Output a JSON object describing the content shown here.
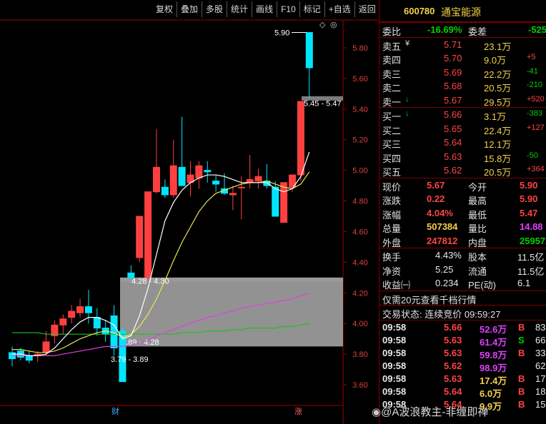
{
  "toolbar": [
    "复权",
    "叠加",
    "多股",
    "统计",
    "画线",
    "F10",
    "标记",
    "+自选",
    "返回"
  ],
  "stock": {
    "code": "600780",
    "name": "通宝能源"
  },
  "quote": {
    "weibi_label": "委比",
    "weibi": "-16.69%",
    "weicha_label": "委差",
    "weicha": "-525",
    "sells": [
      {
        "label": "卖五",
        "price": "5.71",
        "vol": "23.1万",
        "chg": "",
        "mark": "¥"
      },
      {
        "label": "卖四",
        "price": "5.70",
        "vol": "9.0万",
        "chg": "+5",
        "mark": ""
      },
      {
        "label": "卖三",
        "price": "5.69",
        "vol": "22.2万",
        "chg": "-41",
        "mark": ""
      },
      {
        "label": "卖二",
        "price": "5.68",
        "vol": "20.5万",
        "chg": "-210",
        "mark": ""
      },
      {
        "label": "卖一",
        "price": "5.67",
        "vol": "29.5万",
        "chg": "+520",
        "mark": "↓"
      }
    ],
    "buys": [
      {
        "label": "买一",
        "price": "5.66",
        "vol": "3.1万",
        "chg": "-383",
        "mark": "↓"
      },
      {
        "label": "买二",
        "price": "5.65",
        "vol": "22.4万",
        "chg": "+127",
        "mark": ""
      },
      {
        "label": "买三",
        "price": "5.64",
        "vol": "12.1万",
        "chg": "",
        "mark": ""
      },
      {
        "label": "买四",
        "price": "5.63",
        "vol": "15.8万",
        "chg": "-50",
        "mark": ""
      },
      {
        "label": "买五",
        "price": "5.62",
        "vol": "20.5万",
        "chg": "+364",
        "mark": ""
      }
    ],
    "stats": [
      {
        "l1": "现价",
        "v1": "5.67",
        "c1": "red",
        "l2": "今开",
        "v2": "5.90",
        "c2": "red"
      },
      {
        "l1": "涨跌",
        "v1": "0.22",
        "c1": "red",
        "l2": "最高",
        "v2": "5.90",
        "c2": "red"
      },
      {
        "l1": "涨幅",
        "v1": "4.04%",
        "c1": "red",
        "l2": "最低",
        "v2": "5.47",
        "c2": "red"
      },
      {
        "l1": "总量",
        "v1": "507384",
        "c1": "yel",
        "l2": "量比",
        "v2": "14.88",
        "c2": "mag"
      },
      {
        "l1": "外盘",
        "v1": "247812",
        "c1": "red",
        "l2": "内盘",
        "v2": "259572",
        "c2": "grn"
      }
    ],
    "stats2": [
      {
        "l1": "换手",
        "v1": "4.43%",
        "l2": "股本",
        "v2": "11.5亿"
      },
      {
        "l1": "净资",
        "v1": "5.25",
        "l2": "流通",
        "v2": "11.5亿"
      },
      {
        "l1": "收益㈠",
        "v1": "0.234",
        "l2": "PE(动)",
        "v2": "6.1"
      }
    ],
    "notice": "仅需20元查看千档行情",
    "trade_state": "交易状态: 连续竞价 09:59:27",
    "ticks": [
      {
        "t": "09:58",
        "p": "5.66",
        "v": "52.6万",
        "s": "B",
        "n": "83",
        "pc": "red",
        "vc": "mag",
        "sc": "red"
      },
      {
        "t": "09:58",
        "p": "5.63",
        "v": "61.4万",
        "s": "S",
        "n": "66",
        "pc": "red",
        "vc": "mag",
        "sc": "grn"
      },
      {
        "t": "09:58",
        "p": "5.63",
        "v": "59.8万",
        "s": "B",
        "n": "33",
        "pc": "red",
        "vc": "mag",
        "sc": "red"
      },
      {
        "t": "09:58",
        "p": "5.62",
        "v": "98.9万",
        "s": "",
        "n": "62",
        "pc": "red",
        "vc": "mag",
        "sc": "red"
      },
      {
        "t": "09:58",
        "p": "5.63",
        "v": "17.4万",
        "s": "B",
        "n": "17",
        "pc": "red",
        "vc": "yel",
        "sc": "red"
      },
      {
        "t": "09:58",
        "p": "5.64",
        "v": "6.0万",
        "s": "B",
        "n": "18",
        "pc": "red",
        "vc": "yel",
        "sc": "red"
      },
      {
        "t": "09:58",
        "p": "5.64",
        "v": "9.9万",
        "s": "B",
        "n": "15",
        "pc": "red",
        "vc": "yel",
        "sc": "red"
      }
    ]
  },
  "watermark": "@A波浪教主-非缠即禅",
  "chart_data": {
    "type": "candlestick",
    "y_ticks": [
      "5.80",
      "5.60",
      "5.40",
      "5.20",
      "5.00",
      "4.80",
      "4.60",
      "4.40",
      "4.20",
      "4.00",
      "3.80",
      "3.60"
    ],
    "ylim": [
      3.55,
      5.95
    ],
    "candles": [
      {
        "o": 3.81,
        "h": 3.85,
        "l": 3.72,
        "c": 3.77
      },
      {
        "o": 3.82,
        "h": 3.84,
        "l": 3.76,
        "c": 3.78
      },
      {
        "o": 3.79,
        "h": 3.82,
        "l": 3.74,
        "c": 3.76
      },
      {
        "o": 3.79,
        "h": 3.82,
        "l": 3.75,
        "c": 3.8
      },
      {
        "o": 3.81,
        "h": 3.95,
        "l": 3.79,
        "c": 3.88
      },
      {
        "o": 3.92,
        "h": 4.02,
        "l": 3.87,
        "c": 3.99
      },
      {
        "o": 3.99,
        "h": 4.06,
        "l": 3.93,
        "c": 4.03
      },
      {
        "o": 4.04,
        "h": 4.12,
        "l": 4.0,
        "c": 4.08
      },
      {
        "o": 4.07,
        "h": 4.16,
        "l": 4.04,
        "c": 4.11
      },
      {
        "o": 4.11,
        "h": 4.22,
        "l": 4.0,
        "c": 4.07
      },
      {
        "o": 4.04,
        "h": 4.1,
        "l": 3.92,
        "c": 3.97
      },
      {
        "o": 3.97,
        "h": 4.02,
        "l": 3.88,
        "c": 3.93
      },
      {
        "o": 4.05,
        "h": 4.12,
        "l": 3.79,
        "c": 3.84
      },
      {
        "o": 3.95,
        "h": 3.98,
        "l": 3.62,
        "c": 3.62
      },
      {
        "o": 4.33,
        "h": 4.38,
        "l": 4.28,
        "c": 4.3
      },
      {
        "o": 4.43,
        "h": 4.7,
        "l": 4.4,
        "c": 4.7
      },
      {
        "o": 4.3,
        "h": 4.86,
        "l": 4.28,
        "c": 4.86
      },
      {
        "o": 4.86,
        "h": 5.27,
        "l": 4.85,
        "c": 5.02
      },
      {
        "o": 4.89,
        "h": 4.94,
        "l": 4.82,
        "c": 4.84
      },
      {
        "o": 4.84,
        "h": 5.2,
        "l": 4.82,
        "c": 5.03
      },
      {
        "o": 5.02,
        "h": 5.35,
        "l": 4.95,
        "c": 4.9
      },
      {
        "o": 4.92,
        "h": 5.06,
        "l": 4.83,
        "c": 4.97
      },
      {
        "o": 4.95,
        "h": 5.06,
        "l": 4.88,
        "c": 5.03
      },
      {
        "o": 5.0,
        "h": 5.06,
        "l": 4.92,
        "c": 4.99
      },
      {
        "o": 4.93,
        "h": 4.97,
        "l": 4.86,
        "c": 4.91
      },
      {
        "o": 4.88,
        "h": 4.98,
        "l": 4.84,
        "c": 4.85
      },
      {
        "o": 4.84,
        "h": 4.9,
        "l": 4.74,
        "c": 4.85
      },
      {
        "o": 4.89,
        "h": 4.96,
        "l": 4.68,
        "c": 4.89
      },
      {
        "o": 4.92,
        "h": 5.1,
        "l": 4.88,
        "c": 4.94
      },
      {
        "o": 4.93,
        "h": 5.01,
        "l": 4.88,
        "c": 4.96
      },
      {
        "o": 4.93,
        "h": 5.04,
        "l": 4.88,
        "c": 4.9
      },
      {
        "o": 4.89,
        "h": 4.93,
        "l": 4.7,
        "c": 4.7
      },
      {
        "o": 4.66,
        "h": 4.92,
        "l": 4.66,
        "c": 4.92
      },
      {
        "o": 4.89,
        "h": 4.97,
        "l": 4.86,
        "c": 4.97
      },
      {
        "o": 4.97,
        "h": 5.45,
        "l": 4.93,
        "c": 5.45
      },
      {
        "o": 5.9,
        "h": 5.9,
        "l": 5.47,
        "c": 5.67
      }
    ],
    "ma_white": [
      3.8,
      3.8,
      3.79,
      3.79,
      3.8,
      3.84,
      3.9,
      3.96,
      4.01,
      4.04,
      4.04,
      4.02,
      3.99,
      3.9,
      3.92,
      4.05,
      4.23,
      4.45,
      4.67,
      4.79,
      4.87,
      4.92,
      4.95,
      4.97,
      4.97,
      4.96,
      4.94,
      4.92,
      4.92,
      4.92,
      4.92,
      4.88,
      4.86,
      4.88,
      4.96,
      5.12
    ],
    "ma_yellow": [
      3.83,
      3.83,
      3.82,
      3.81,
      3.81,
      3.82,
      3.84,
      3.87,
      3.9,
      3.92,
      3.94,
      3.95,
      3.94,
      3.91,
      3.93,
      3.98,
      4.06,
      4.16,
      4.28,
      4.41,
      4.53,
      4.63,
      4.73,
      4.8,
      4.85,
      4.87,
      4.89,
      4.91,
      4.92,
      4.92,
      4.93,
      4.91,
      4.89,
      4.88,
      4.91,
      4.99
    ],
    "ma_magenta": [
      3.79,
      3.79,
      3.79,
      3.79,
      3.79,
      3.79,
      3.8,
      3.81,
      3.82,
      3.83,
      3.84,
      3.85,
      3.85,
      3.85,
      3.86,
      3.87,
      3.89,
      3.92,
      3.94,
      3.96,
      3.98,
      4.0,
      4.02,
      4.04,
      4.05,
      4.07,
      4.08,
      4.1,
      4.11,
      4.12,
      4.13,
      4.14,
      4.15,
      4.16,
      4.18,
      4.2
    ],
    "ma_green": [
      3.94,
      3.94,
      3.94,
      3.94,
      3.93,
      3.93,
      3.93,
      3.93,
      3.93,
      3.93,
      3.93,
      3.93,
      3.93,
      3.93,
      3.93,
      3.93,
      3.93,
      3.93,
      3.93,
      3.93,
      3.94,
      3.94,
      3.94,
      3.95,
      3.95,
      3.95,
      3.96,
      3.96,
      3.97,
      3.97,
      3.97,
      3.97,
      3.98,
      3.98,
      3.99,
      4.0
    ],
    "zones": [
      {
        "label": "4.28 - 4.30",
        "from": 4.28,
        "to": 4.3
      },
      {
        "label": "3.89 - 4.28",
        "from": 3.89,
        "to": 4.28
      },
      {
        "label": "5.45 - 5.47",
        "from": 5.45,
        "to": 5.47
      }
    ],
    "annotations": [
      {
        "label": "5.90",
        "value": 5.9
      },
      {
        "label": "3.79 - 3.89",
        "value": 3.62
      }
    ],
    "markers": [
      "财",
      "涨"
    ]
  }
}
